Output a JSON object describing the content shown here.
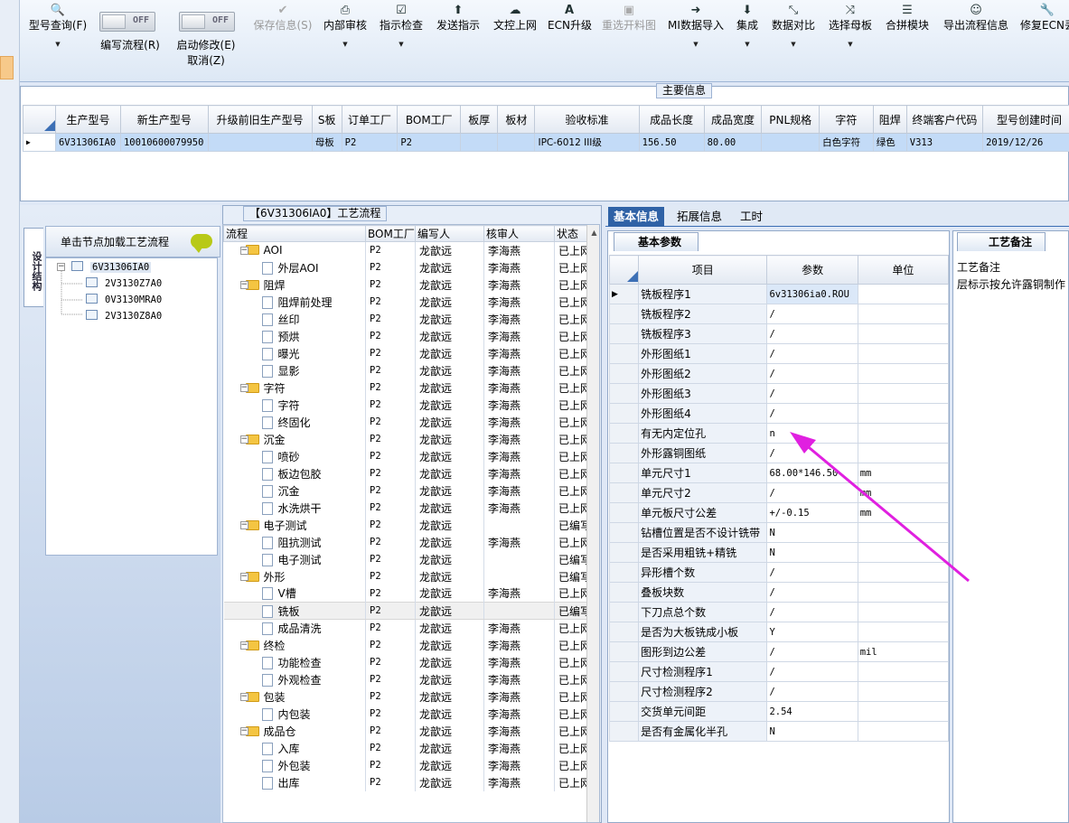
{
  "toolbar": {
    "buttons": [
      {
        "label": "型号查询(F)",
        "icon": "search-icon"
      },
      {
        "label": "保存信息(S)",
        "icon": "check-icon"
      },
      {
        "label": "内部审核",
        "icon": "print-icon"
      },
      {
        "label": "指示检查",
        "icon": "checkbox-icon"
      },
      {
        "label": "发送指示",
        "icon": "upload-icon"
      },
      {
        "label": "文控上网",
        "icon": "cloud-upload-icon"
      },
      {
        "label": "ECN升级",
        "icon": "font-icon"
      },
      {
        "label": "重选开料图",
        "icon": "image-icon"
      },
      {
        "label": "MI数据导入",
        "icon": "sign-in-icon"
      },
      {
        "label": "集成",
        "icon": "download-icon"
      },
      {
        "label": "数据对比",
        "icon": "compress-icon"
      },
      {
        "label": "选择母板",
        "icon": "random-icon"
      },
      {
        "label": "合拼模块",
        "icon": "list-icon"
      },
      {
        "label": "导出流程信息",
        "icon": "smile-icon"
      },
      {
        "label": "修复ECN丢",
        "icon": "wrench-icon"
      }
    ],
    "toggles": [
      {
        "state": "OFF",
        "label": "编写流程(R)"
      },
      {
        "state": "OFF",
        "label": "启动修改(E)",
        "label2": "取消(Z)"
      }
    ]
  },
  "main_info": {
    "title": "主要信息",
    "columns": [
      "生产型号",
      "新生产型号",
      "升级前旧生产型号",
      "S板",
      "订单工厂",
      "BOM工厂",
      "板厚",
      "板材",
      "验收标准",
      "成品长度",
      "成品宽度",
      "PNL规格",
      "字符",
      "阻焊",
      "终端客户代码",
      "型号创建时间"
    ],
    "row": [
      "6V31306IA0",
      "10010600079950",
      "",
      "母板",
      "P2",
      "P2",
      "",
      "",
      "IPC-6012 III级",
      "156.50",
      "80.00",
      "",
      "白色字符",
      "绿色",
      "V313",
      "2019/12/26"
    ]
  },
  "left_panel": {
    "vtab_label": "设计结构",
    "header": "单击节点加载工艺流程",
    "tree": {
      "root": "6V31306IA0",
      "children": [
        "2V3130Z7A0",
        "0V3130MRA0",
        "2V3130Z8A0"
      ]
    }
  },
  "process": {
    "title": "【6V31306IA0】工艺流程",
    "columns": [
      "流程",
      "BOM工厂",
      "编写人",
      "核审人",
      "状态"
    ],
    "rows": [
      {
        "type": "group",
        "name": "AOI",
        "bom": "P2",
        "writer": "龙歆远",
        "reviewer": "李海燕",
        "status": "已上网"
      },
      {
        "type": "item",
        "name": "外层AOI",
        "bom": "P2",
        "writer": "龙歆远",
        "reviewer": "李海燕",
        "status": "已上网"
      },
      {
        "type": "group",
        "name": "阻焊",
        "bom": "P2",
        "writer": "龙歆远",
        "reviewer": "李海燕",
        "status": "已上网"
      },
      {
        "type": "item",
        "name": "阻焊前处理",
        "bom": "P2",
        "writer": "龙歆远",
        "reviewer": "李海燕",
        "status": "已上网"
      },
      {
        "type": "item",
        "name": "丝印",
        "bom": "P2",
        "writer": "龙歆远",
        "reviewer": "李海燕",
        "status": "已上网"
      },
      {
        "type": "item",
        "name": "预烘",
        "bom": "P2",
        "writer": "龙歆远",
        "reviewer": "李海燕",
        "status": "已上网"
      },
      {
        "type": "item",
        "name": "曝光",
        "bom": "P2",
        "writer": "龙歆远",
        "reviewer": "李海燕",
        "status": "已上网"
      },
      {
        "type": "item",
        "name": "显影",
        "bom": "P2",
        "writer": "龙歆远",
        "reviewer": "李海燕",
        "status": "已上网"
      },
      {
        "type": "group",
        "name": "字符",
        "bom": "P2",
        "writer": "龙歆远",
        "reviewer": "李海燕",
        "status": "已上网"
      },
      {
        "type": "item",
        "name": "字符",
        "bom": "P2",
        "writer": "龙歆远",
        "reviewer": "李海燕",
        "status": "已上网"
      },
      {
        "type": "item",
        "name": "终固化",
        "bom": "P2",
        "writer": "龙歆远",
        "reviewer": "李海燕",
        "status": "已上网"
      },
      {
        "type": "group",
        "name": "沉金",
        "bom": "P2",
        "writer": "龙歆远",
        "reviewer": "李海燕",
        "status": "已上网"
      },
      {
        "type": "item",
        "name": "喷砂",
        "bom": "P2",
        "writer": "龙歆远",
        "reviewer": "李海燕",
        "status": "已上网"
      },
      {
        "type": "item",
        "name": "板边包胶",
        "bom": "P2",
        "writer": "龙歆远",
        "reviewer": "李海燕",
        "status": "已上网"
      },
      {
        "type": "item",
        "name": "沉金",
        "bom": "P2",
        "writer": "龙歆远",
        "reviewer": "李海燕",
        "status": "已上网"
      },
      {
        "type": "item",
        "name": "水洗烘干",
        "bom": "P2",
        "writer": "龙歆远",
        "reviewer": "李海燕",
        "status": "已上网"
      },
      {
        "type": "group",
        "name": "电子测试",
        "bom": "P2",
        "writer": "龙歆远",
        "reviewer": "",
        "status": "已编写"
      },
      {
        "type": "item",
        "name": "阻抗测试",
        "bom": "P2",
        "writer": "龙歆远",
        "reviewer": "李海燕",
        "status": "已上网"
      },
      {
        "type": "item",
        "name": "电子测试",
        "bom": "P2",
        "writer": "龙歆远",
        "reviewer": "",
        "status": "已编写"
      },
      {
        "type": "group",
        "name": "外形",
        "bom": "P2",
        "writer": "龙歆远",
        "reviewer": "",
        "status": "已编写"
      },
      {
        "type": "item",
        "name": "V槽",
        "bom": "P2",
        "writer": "龙歆远",
        "reviewer": "李海燕",
        "status": "已上网"
      },
      {
        "type": "item",
        "name": "铣板",
        "bom": "P2",
        "writer": "龙歆远",
        "reviewer": "",
        "status": "已编写",
        "selected": true
      },
      {
        "type": "item",
        "name": "成品清洗",
        "bom": "P2",
        "writer": "龙歆远",
        "reviewer": "李海燕",
        "status": "已上网"
      },
      {
        "type": "group",
        "name": "终检",
        "bom": "P2",
        "writer": "龙歆远",
        "reviewer": "李海燕",
        "status": "已上网"
      },
      {
        "type": "item",
        "name": "功能检查",
        "bom": "P2",
        "writer": "龙歆远",
        "reviewer": "李海燕",
        "status": "已上网"
      },
      {
        "type": "item",
        "name": "外观检查",
        "bom": "P2",
        "writer": "龙歆远",
        "reviewer": "李海燕",
        "status": "已上网"
      },
      {
        "type": "group",
        "name": "包装",
        "bom": "P2",
        "writer": "龙歆远",
        "reviewer": "李海燕",
        "status": "已上网"
      },
      {
        "type": "item",
        "name": "内包装",
        "bom": "P2",
        "writer": "龙歆远",
        "reviewer": "李海燕",
        "status": "已上网"
      },
      {
        "type": "group",
        "name": "成品仓",
        "bom": "P2",
        "writer": "龙歆远",
        "reviewer": "李海燕",
        "status": "已上网"
      },
      {
        "type": "item",
        "name": "入库",
        "bom": "P2",
        "writer": "龙歆远",
        "reviewer": "李海燕",
        "status": "已上网"
      },
      {
        "type": "item",
        "name": "外包装",
        "bom": "P2",
        "writer": "龙歆远",
        "reviewer": "李海燕",
        "status": "已上网"
      },
      {
        "type": "item",
        "name": "出库",
        "bom": "P2",
        "writer": "龙歆远",
        "reviewer": "李海燕",
        "status": "已上网"
      }
    ]
  },
  "detail": {
    "tabs": [
      "基本信息",
      "拓展信息",
      "工时"
    ],
    "subtab": "基本参数",
    "columns": [
      "项目",
      "参数",
      "单位"
    ],
    "params": [
      {
        "item": "铣板程序1",
        "value": "6v31306ia0.ROU",
        "unit": ""
      },
      {
        "item": "铣板程序2",
        "value": "/",
        "unit": ""
      },
      {
        "item": "铣板程序3",
        "value": "/",
        "unit": ""
      },
      {
        "item": "外形图纸1",
        "value": "/",
        "unit": ""
      },
      {
        "item": "外形图纸2",
        "value": "/",
        "unit": ""
      },
      {
        "item": "外形图纸3",
        "value": "/",
        "unit": ""
      },
      {
        "item": "外形图纸4",
        "value": "/",
        "unit": ""
      },
      {
        "item": "有无内定位孔",
        "value": "n",
        "unit": ""
      },
      {
        "item": "外形露铜图纸",
        "value": "/",
        "unit": ""
      },
      {
        "item": "单元尺寸1",
        "value": "68.00*146.50",
        "unit": "mm"
      },
      {
        "item": "单元尺寸2",
        "value": "/",
        "unit": "mm"
      },
      {
        "item": "单元板尺寸公差",
        "value": "+/-0.15",
        "unit": "mm"
      },
      {
        "item": "钻槽位置是否不设计铣带",
        "value": "N",
        "unit": ""
      },
      {
        "item": "是否采用粗铣+精铣",
        "value": "N",
        "unit": ""
      },
      {
        "item": "异形槽个数",
        "value": "/",
        "unit": ""
      },
      {
        "item": "叠板块数",
        "value": "/",
        "unit": ""
      },
      {
        "item": "下刀点总个数",
        "value": "/",
        "unit": ""
      },
      {
        "item": "是否为大板铣成小板",
        "value": "Y",
        "unit": ""
      },
      {
        "item": "图形到边公差",
        "value": "/",
        "unit": "mil"
      },
      {
        "item": "尺寸检测程序1",
        "value": "/",
        "unit": ""
      },
      {
        "item": "尺寸检测程序2",
        "value": "/",
        "unit": ""
      },
      {
        "item": "交货单元间距",
        "value": "2.54",
        "unit": ""
      },
      {
        "item": "是否有金属化半孔",
        "value": "N",
        "unit": ""
      }
    ]
  },
  "notes": {
    "tab": "工艺备注",
    "label": "工艺备注",
    "text": "层标示按允许露铜制作"
  },
  "colors": {
    "accent": "#2f62a6",
    "selection": "#c3dbf7",
    "arrow": "#e020e0"
  }
}
